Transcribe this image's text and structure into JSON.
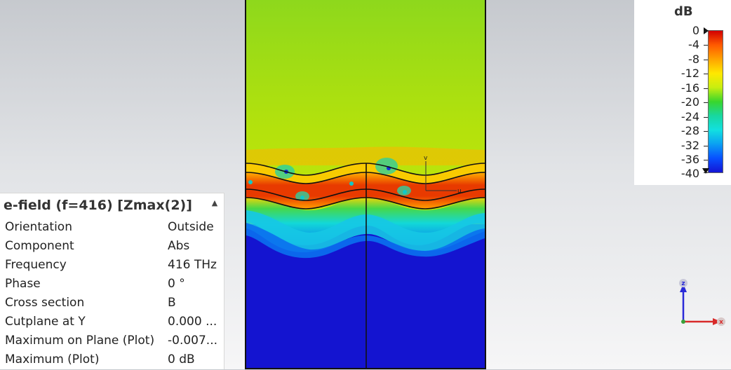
{
  "info_panel": {
    "title": "e-field (f=416) [Zmax(2)]",
    "rows": [
      {
        "label": "Orientation",
        "value": "Outside"
      },
      {
        "label": "Component",
        "value": "Abs"
      },
      {
        "label": "Frequency",
        "value": "416 THz"
      },
      {
        "label": "Phase",
        "value": "0 °"
      },
      {
        "label": "Cross section",
        "value": "B"
      },
      {
        "label": "Cutplane at Y",
        "value": "0.000 ..."
      },
      {
        "label": "Maximum on Plane (Plot)",
        "value": "-0.007..."
      },
      {
        "label": "Maximum (Plot)",
        "value": "0 dB"
      }
    ]
  },
  "legend": {
    "unit": "dB",
    "labels": [
      "0",
      "-4",
      "-8",
      "-12",
      "-16",
      "-20",
      "-24",
      "-28",
      "-32",
      "-36",
      "-40"
    ]
  },
  "axes": {
    "z_label": "z",
    "x_label": "x"
  },
  "plot": {
    "marker_v": "v",
    "marker_u": "u"
  },
  "colors": {
    "field_top": "#b8e40a",
    "field_bottom": "#1414d0",
    "field_peak": "#e02800"
  }
}
